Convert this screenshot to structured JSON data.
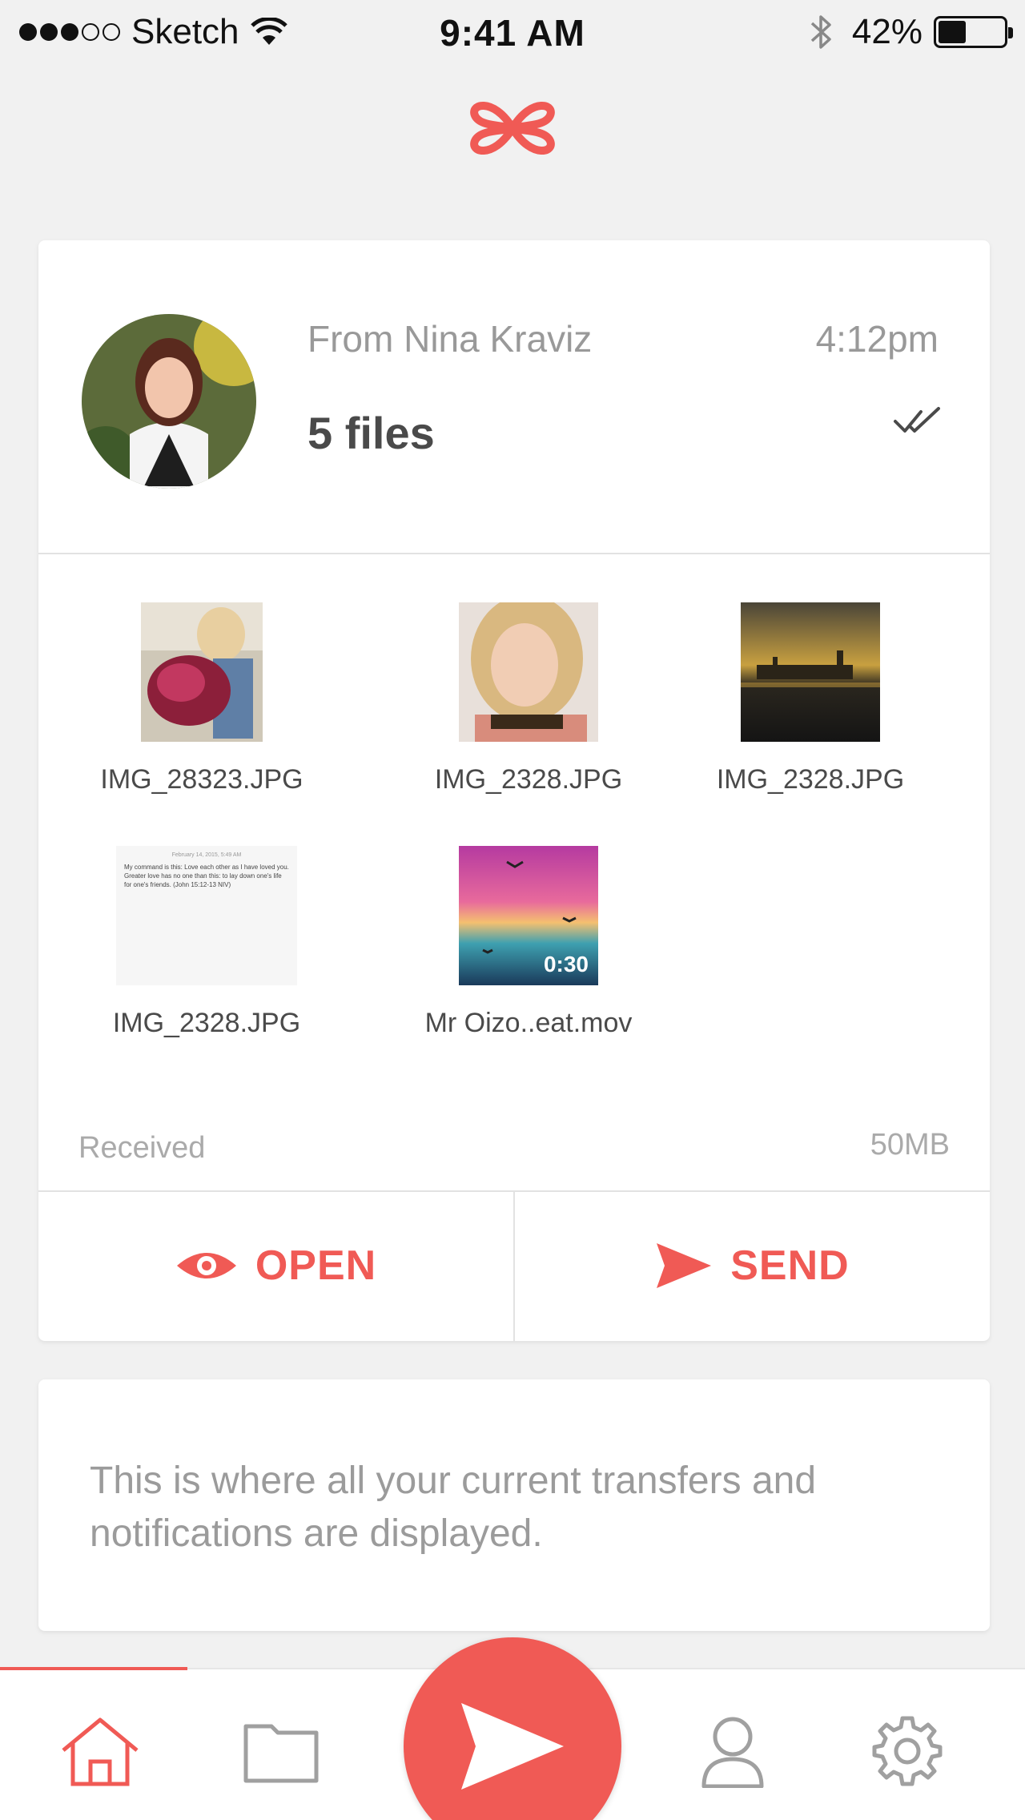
{
  "status_bar": {
    "carrier": "Sketch",
    "time": "9:41 AM",
    "battery_percent": "42%",
    "battery_level": 0.42
  },
  "transfer": {
    "sender": "From Nina Kraviz",
    "time": "4:12pm",
    "file_count": "5 files",
    "status_icon": "double-check-icon",
    "files": [
      {
        "name": "IMG_28323.JPG",
        "type": "image"
      },
      {
        "name": "IMG_2328.JPG",
        "type": "image"
      },
      {
        "name": "IMG_2328.JPG",
        "type": "image"
      },
      {
        "name": "IMG_2328.JPG",
        "type": "image"
      },
      {
        "name": "Mr Oizo..eat.mov",
        "type": "video",
        "duration": "0:30"
      }
    ],
    "doc_preview": {
      "date": "February 14, 2015, 5:49 AM",
      "text": "My command is this: Love each other as I have loved you. Greater love has no one than this: to lay down one's life for one's friends. (John 15:12-13 NIV)"
    },
    "status_text": "Received",
    "total_size": "50MB",
    "open_label": "OPEN",
    "send_label": "SEND"
  },
  "info": {
    "text": "This is where all your current transfers and notifications are displayed."
  },
  "colors": {
    "accent": "#f05a55",
    "background": "#f1f1f1",
    "muted_text": "#9b9b9b"
  },
  "tabs": [
    {
      "icon": "home-icon",
      "active": true
    },
    {
      "icon": "folder-icon",
      "active": false
    },
    {
      "icon": "send-icon",
      "active": false
    },
    {
      "icon": "user-icon",
      "active": false
    },
    {
      "icon": "gear-icon",
      "active": false
    }
  ]
}
